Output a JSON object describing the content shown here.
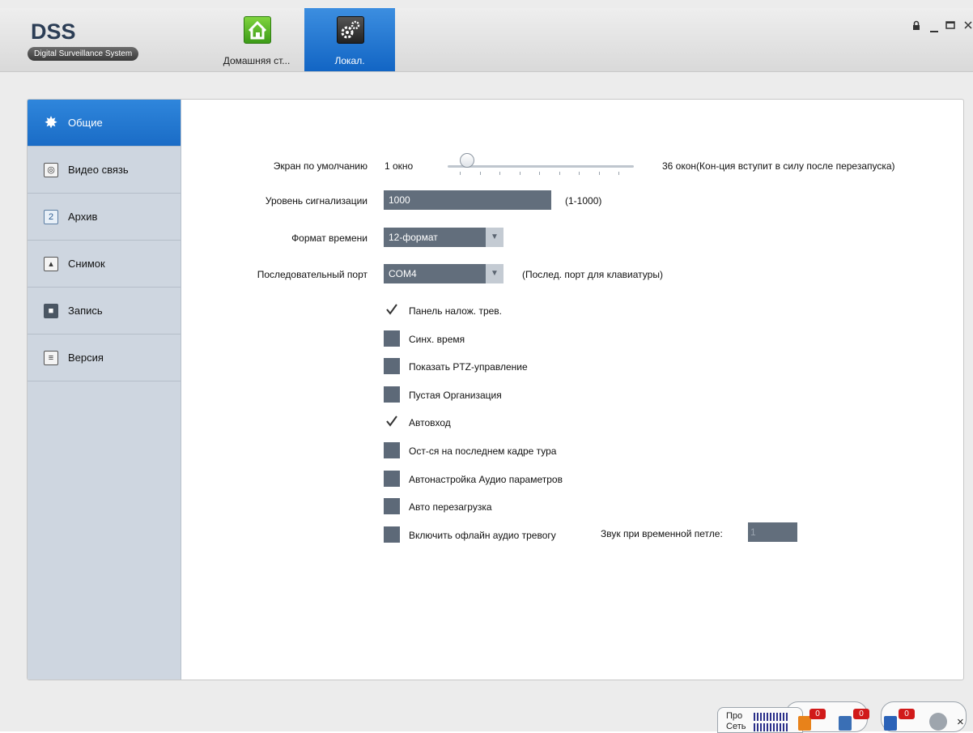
{
  "app": {
    "logo_title": "DSS",
    "logo_subtitle": "Digital Surveillance System",
    "window_controls": [
      "lock-icon",
      "minimize-icon",
      "maximize-icon",
      "close-icon"
    ]
  },
  "tabs": [
    {
      "label": "Домашняя ст...",
      "icon": "home-icon",
      "active": false
    },
    {
      "label": "Локал.",
      "icon": "gears-icon",
      "active": true
    }
  ],
  "sidebar": {
    "items": [
      {
        "label": "Общие",
        "icon": "gear-icon",
        "active": true
      },
      {
        "label": "Видео связь",
        "icon": "camera-icon",
        "active": false
      },
      {
        "label": "Архив",
        "icon": "clapper-icon",
        "active": false
      },
      {
        "label": "Снимок",
        "icon": "picture-icon",
        "active": false
      },
      {
        "label": "Запись",
        "icon": "video-camera-icon",
        "active": false
      },
      {
        "label": "Версия",
        "icon": "list-icon",
        "active": false
      }
    ]
  },
  "settings": {
    "default_screen": {
      "label": "Экран по умолчанию",
      "min_text": "1 окно",
      "max_text": "36 окон(Кон-ция вступит в силу после перезапуска)",
      "level": 0.06
    },
    "alarm_level": {
      "label": "Уровень сигнализации",
      "value": "1000",
      "hint": "(1-1000)"
    },
    "time_format": {
      "label": "Формат времени",
      "value": "12-формат"
    },
    "serial_port": {
      "label": "Последовательный порт",
      "value": "COM4",
      "hint": "(Послед. порт для клавиатуры)"
    },
    "checkboxes": [
      {
        "label": "Панель налож. трев.",
        "checked": true
      },
      {
        "label": "Синх. время",
        "checked": false
      },
      {
        "label": "Показать PTZ-управление",
        "checked": false
      },
      {
        "label": "Пустая Организация",
        "checked": false
      },
      {
        "label": "Автовход",
        "checked": true
      },
      {
        "label": "Ост-ся на последнем кадре тура",
        "checked": false
      },
      {
        "label": "Автонастройка Аудио параметров",
        "checked": false
      },
      {
        "label": "Авто перезагрузка",
        "checked": false
      },
      {
        "label": "Включить офлайн аудио тревогу",
        "checked": false
      }
    ],
    "loop_sound": {
      "label": "Звук при временной петле:",
      "value": "1"
    }
  },
  "statusbar": {
    "cpu_label": "Про",
    "net_label": "Сеть",
    "badges": [
      "0",
      "0",
      "0"
    ],
    "close": "×",
    "colors": {
      "badge": "#d11a1a",
      "bars": "#2a2f8a"
    }
  },
  "colors": {
    "accent": "#1a6cc6",
    "field": "#626e7c",
    "sidebar": "#ced6e0"
  }
}
